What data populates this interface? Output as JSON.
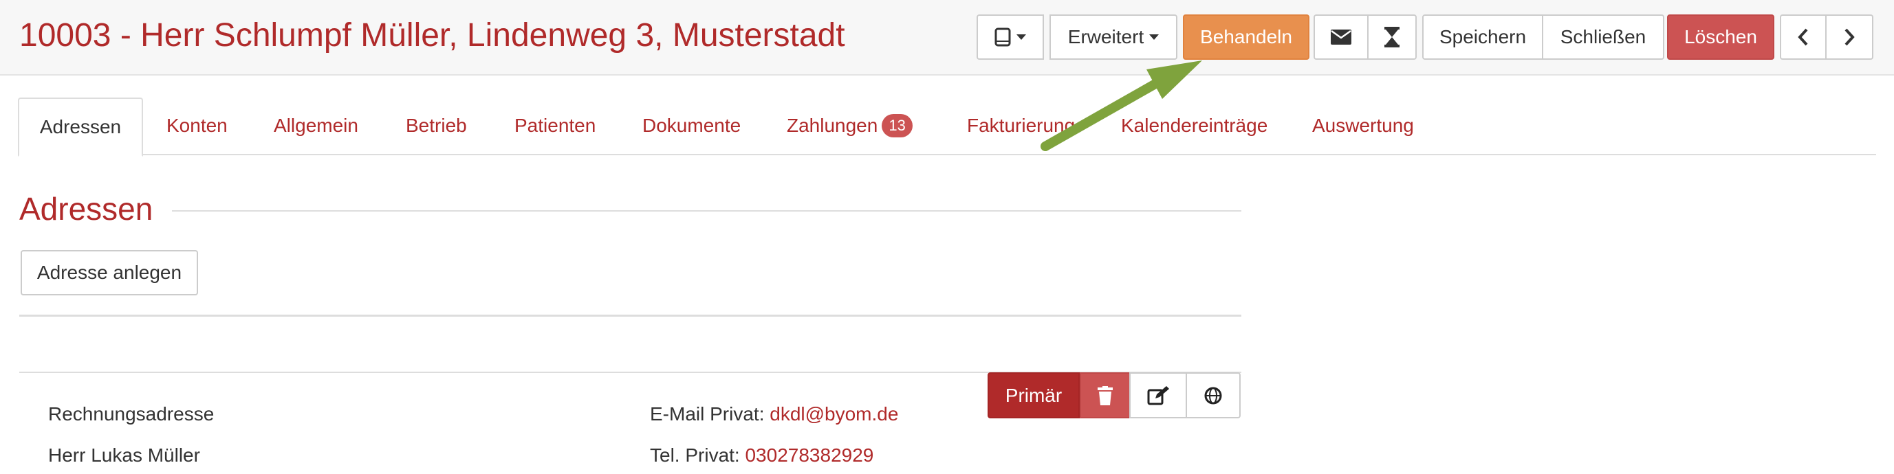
{
  "header": {
    "title": "10003 - Herr Schlumpf Müller, Lindenweg 3, Musterstadt",
    "toolbar": {
      "device_icon": "tablet-icon",
      "erweitert_label": "Erweitert",
      "behandeln_label": "Behandeln",
      "mail_icon": "envelope-icon",
      "hourglass_icon": "hourglass-icon",
      "speichern_label": "Speichern",
      "schliessen_label": "Schließen",
      "loeschen_label": "Löschen",
      "prev_icon": "chevron-left-icon",
      "next_icon": "chevron-right-icon"
    }
  },
  "tabs": [
    {
      "label": "Adressen",
      "active": true
    },
    {
      "label": "Konten"
    },
    {
      "label": "Allgemein"
    },
    {
      "label": "Betrieb"
    },
    {
      "label": "Patienten"
    },
    {
      "label": "Dokumente"
    },
    {
      "label": "Zahlungen",
      "badge": "13"
    },
    {
      "label": "Fakturierung"
    },
    {
      "label": "Kalendereinträge"
    },
    {
      "label": "Auswertung"
    }
  ],
  "section": {
    "title": "Adressen",
    "new_address_label": "Adresse anlegen"
  },
  "address": {
    "type": "Rechnungsadresse",
    "name": "Herr Lukas Müller",
    "email_label": "E-Mail Privat:",
    "email_value": "dkdl@byom.de",
    "phone_label": "Tel. Privat:",
    "phone_value": "030278382929",
    "primary_label": "Primär",
    "delete_icon": "trash-icon",
    "edit_icon": "edit-icon",
    "globe_icon": "globe-icon"
  },
  "colors": {
    "brand_red": "#b02a2a",
    "danger_red": "#cc5353",
    "orange": "#e8904e",
    "arrow_green": "#7fa33d"
  }
}
